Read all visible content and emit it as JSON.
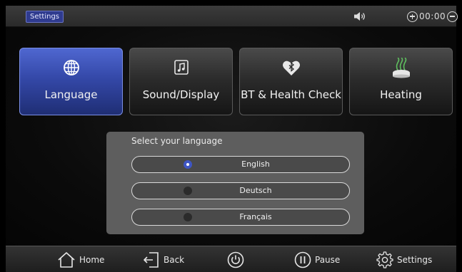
{
  "header": {
    "breadcrumb": "Settings",
    "timer": "00:00",
    "icons": [
      "speaker-icon",
      "plus-circle-icon",
      "minus-circle-icon"
    ]
  },
  "tabs": [
    {
      "label": "Language",
      "icon": "globe-icon",
      "active": true
    },
    {
      "label": "Sound/Display",
      "icon": "music-note-icon",
      "active": false
    },
    {
      "label": "BT & Health Check",
      "icon": "bluetooth-heart-icon",
      "active": false
    },
    {
      "label": "Heating",
      "icon": "heating-icon",
      "active": false
    }
  ],
  "language_dialog": {
    "title": "Select your language",
    "options": [
      {
        "label": "English",
        "selected": true
      },
      {
        "label": "Deutsch",
        "selected": false
      },
      {
        "label": "Français",
        "selected": false
      }
    ]
  },
  "bottom_bar": {
    "home_label": "Home",
    "back_label": "Back",
    "pause_label": "Pause",
    "settings_label": "Settings",
    "icons": [
      "home-icon",
      "back-icon",
      "power-icon",
      "pause-icon",
      "gear-icon"
    ]
  },
  "colors": {
    "accent": "#3448a8",
    "selected_radio": "#3f56c4",
    "dialog_bg": "#5e5e5e"
  }
}
